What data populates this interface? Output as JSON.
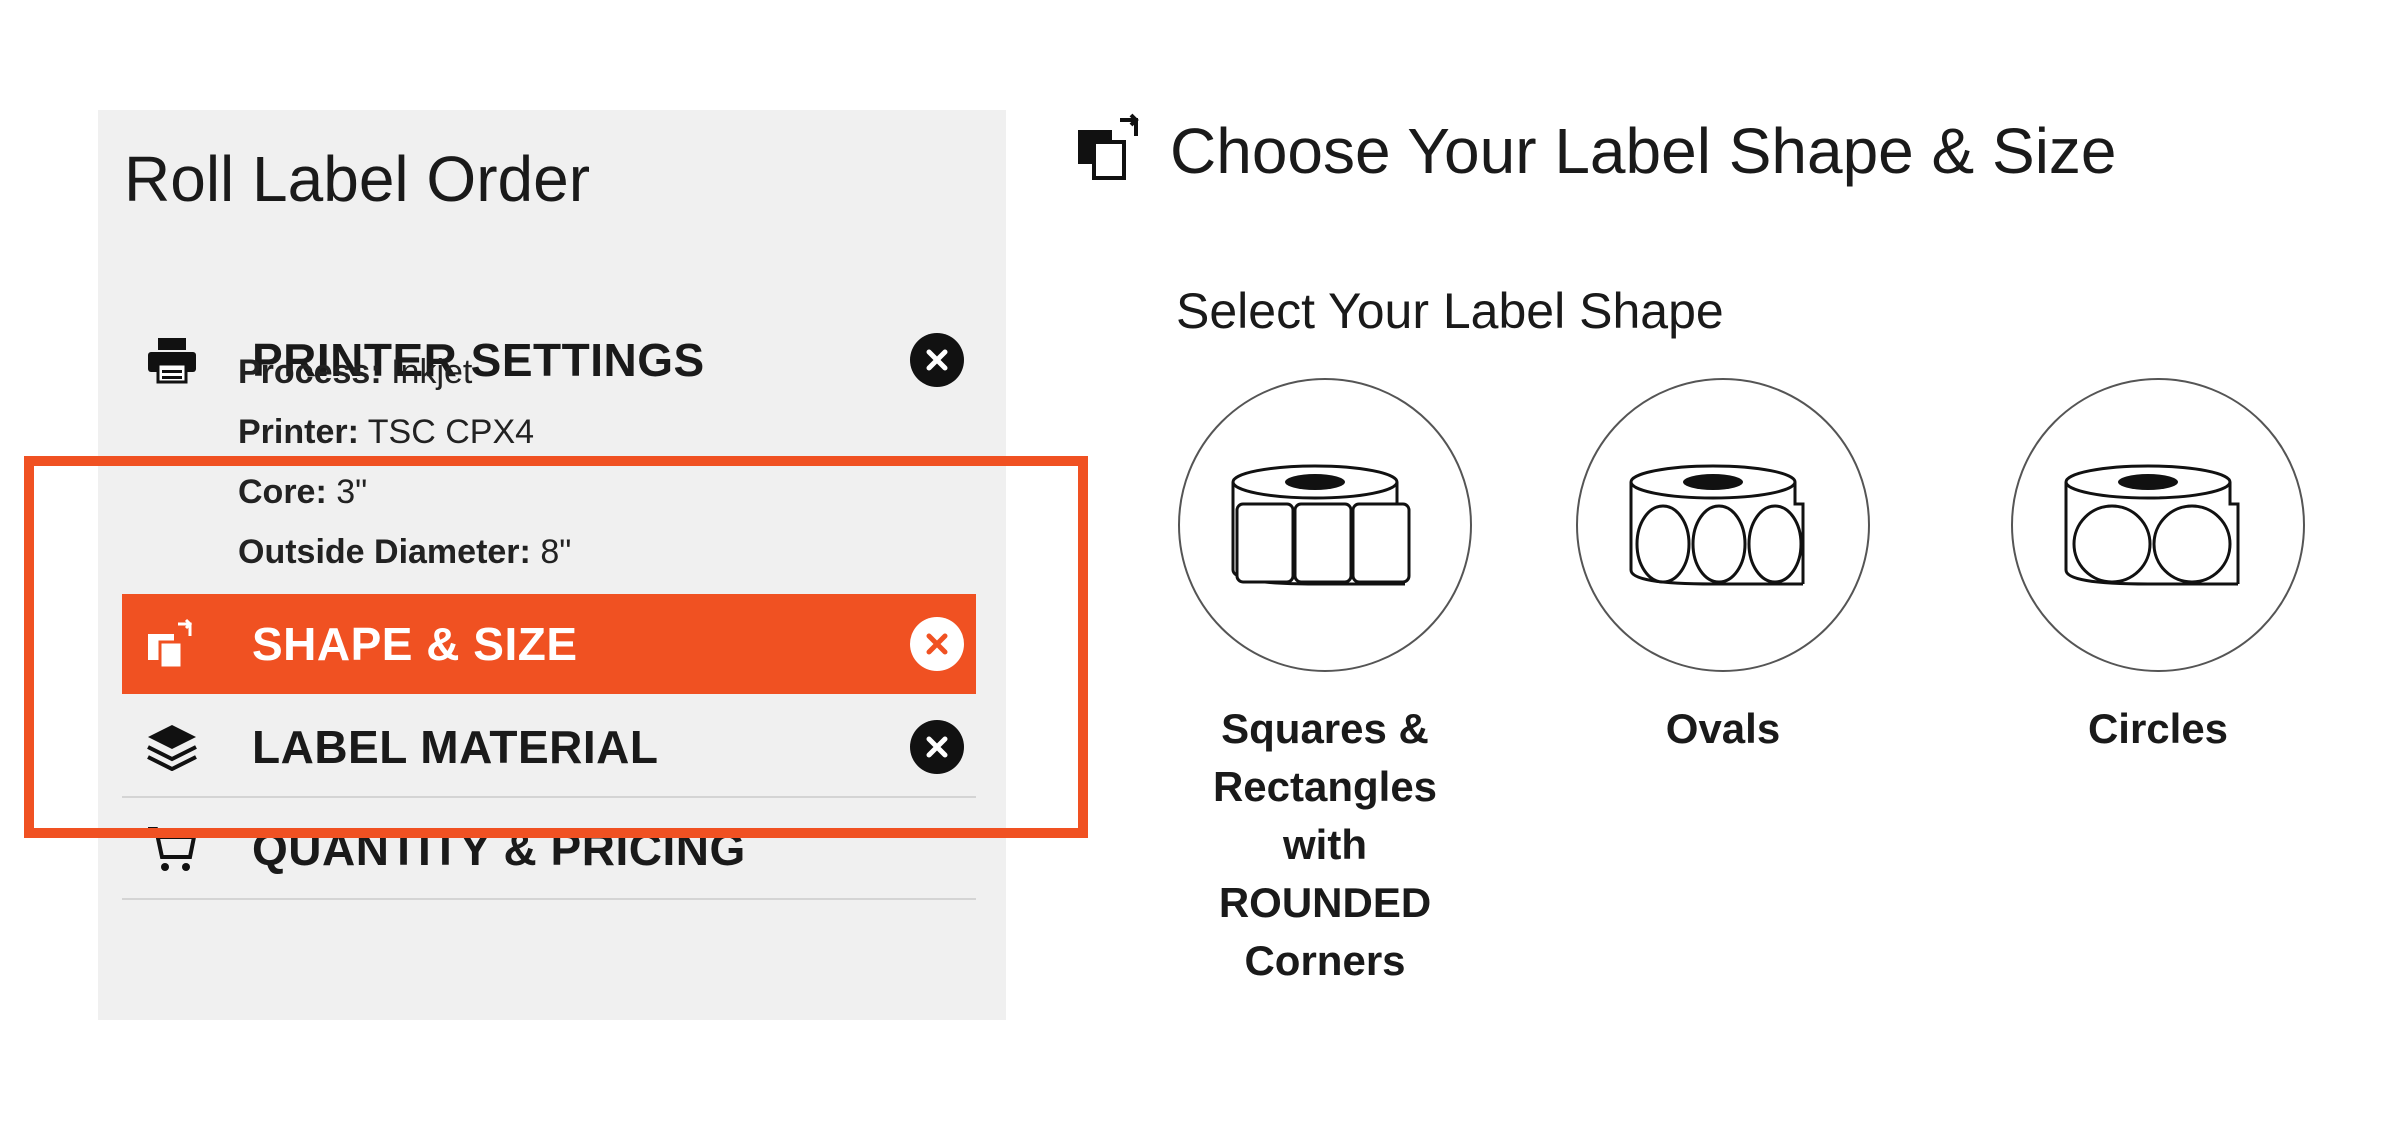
{
  "sidebar": {
    "title": "Roll Label Order",
    "steps": [
      {
        "label": "PRINTER SETTINGS",
        "icon": "printer-icon"
      },
      {
        "label": "SHAPE & SIZE",
        "icon": "shape-swap-icon"
      },
      {
        "label": "LABEL MATERIAL",
        "icon": "layers-icon"
      },
      {
        "label": "QUANTITY & PRICING",
        "icon": "cart-icon"
      }
    ],
    "printer_details": [
      {
        "key": "Process:",
        "value": "Inkjet"
      },
      {
        "key": "Printer:",
        "value": "TSC CPX4"
      },
      {
        "key": "Core:",
        "value": "3\""
      },
      {
        "key": "Outside Diameter:",
        "value": "8\""
      }
    ]
  },
  "main": {
    "title": "Choose Your Label Shape & Size",
    "subtitle": "Select Your Label Shape",
    "shapes": [
      {
        "lines": [
          "Squares &",
          "Rectangles",
          "with",
          "ROUNDED",
          "Corners"
        ]
      },
      {
        "lines": [
          "Ovals"
        ]
      },
      {
        "lines": [
          "Circles"
        ]
      }
    ]
  },
  "colors": {
    "accent": "#f05122",
    "sidebar_bg": "#f0f0f0"
  }
}
